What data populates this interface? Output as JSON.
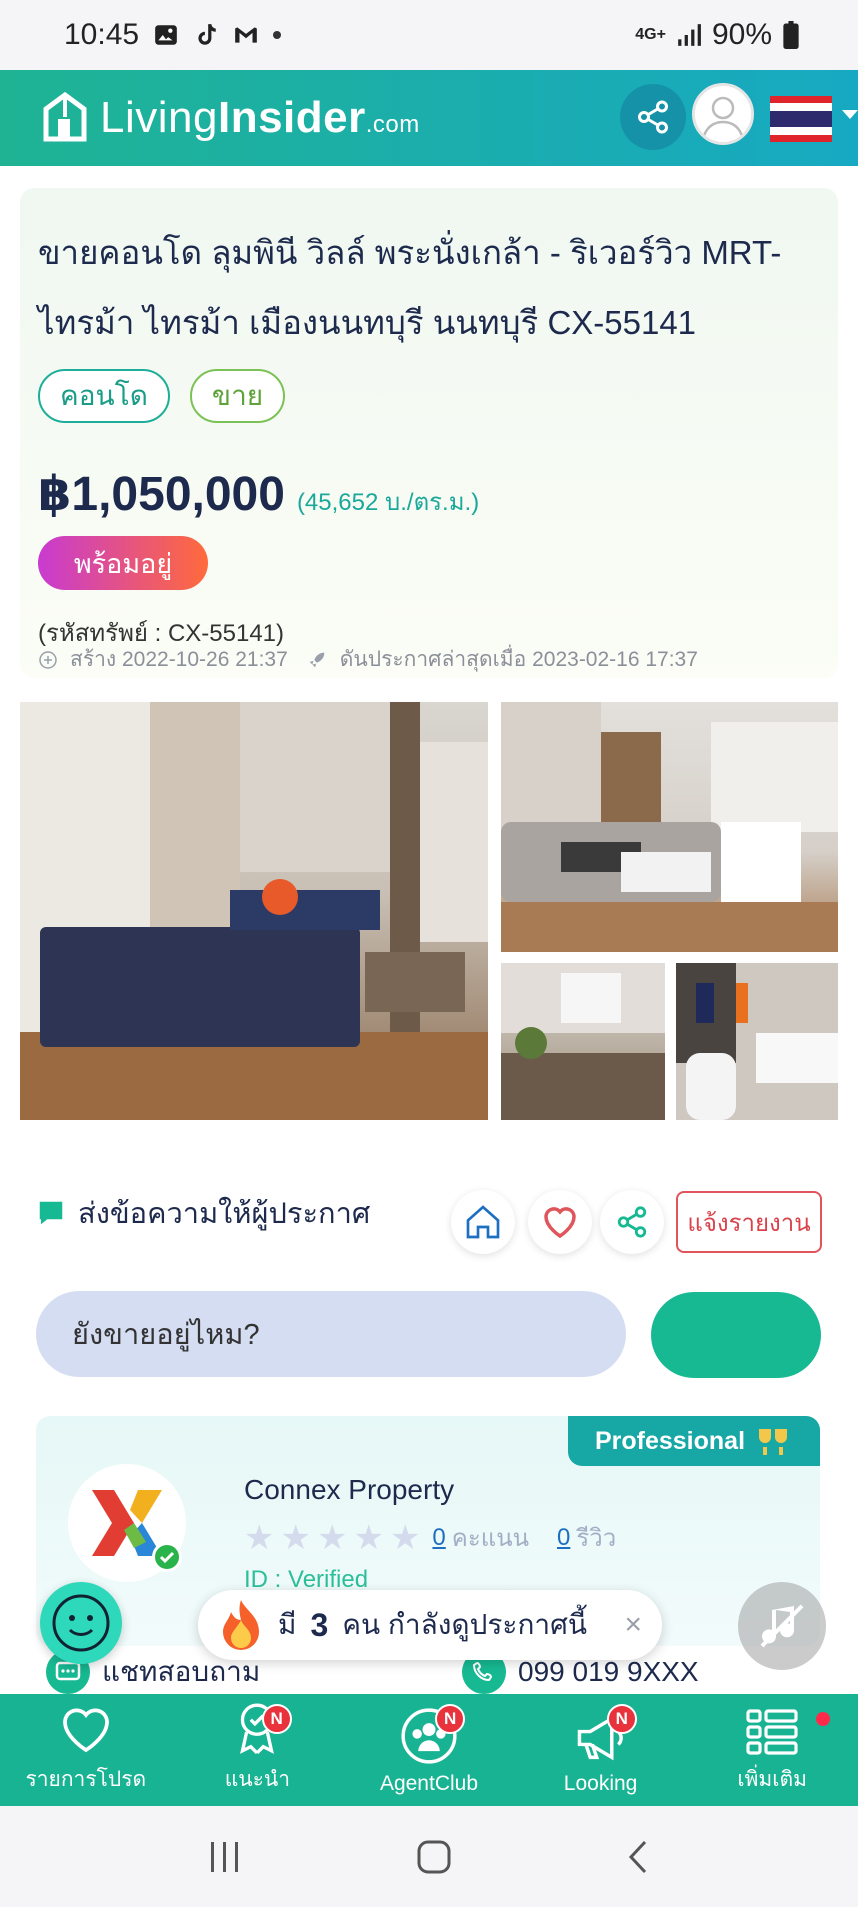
{
  "status_bar": {
    "time": "10:45",
    "network": "4G+",
    "battery": "90%"
  },
  "header": {
    "logo_living": "Living",
    "logo_insider": "Insider",
    "logo_com": ".com"
  },
  "listing": {
    "title": "ขายคอนโด ลุมพินี วิลล์ พระนั่งเกล้า - ริเวอร์วิว MRT-ไทรม้า ไทรม้า เมืองนนทบุรี นนทบุรี CX-55141",
    "tags": [
      "คอนโด",
      "ขาย"
    ],
    "price": "฿1,050,000",
    "price_per_sqm": "(45,652 บ./ตร.ม.)",
    "status_badge": "พร้อมอยู่",
    "asset_code": "(รหัสทรัพย์ : CX-55141)",
    "created": "สร้าง 2022-10-26 21:37",
    "last_boost": "ดันประกาศล่าสุดเมื่อ 2023-02-16 17:37"
  },
  "message": {
    "label": "ส่งข้อความให้ผู้ประกาศ",
    "report_label": "แจ้งรายงาน",
    "input_value": "ยังขายอยู่ไหม?"
  },
  "agent": {
    "badge": "Professional",
    "name": "Connex Property",
    "score": "0",
    "score_label": "คะแนน",
    "reviews": "0",
    "reviews_label": "รีวิว",
    "id_text": "ID : Verified",
    "chat_label": "แชทสอบถาม",
    "phone": "099 019 9XXX"
  },
  "toast": {
    "prefix": "มี",
    "count": "3",
    "suffix": "คน กำลังดูประกาศนี้",
    "close": "×"
  },
  "bottom_nav": [
    {
      "label": "รายการโปรด",
      "badge": ""
    },
    {
      "label": "แนะนำ",
      "badge": "N"
    },
    {
      "label": "AgentClub",
      "badge": "N"
    },
    {
      "label": "Looking",
      "badge": "N"
    },
    {
      "label": "เพิ่มเติม",
      "badge": ""
    }
  ],
  "colors": {
    "brand": "#18b392",
    "price": "#1d2a4d",
    "report": "#d9444c"
  }
}
